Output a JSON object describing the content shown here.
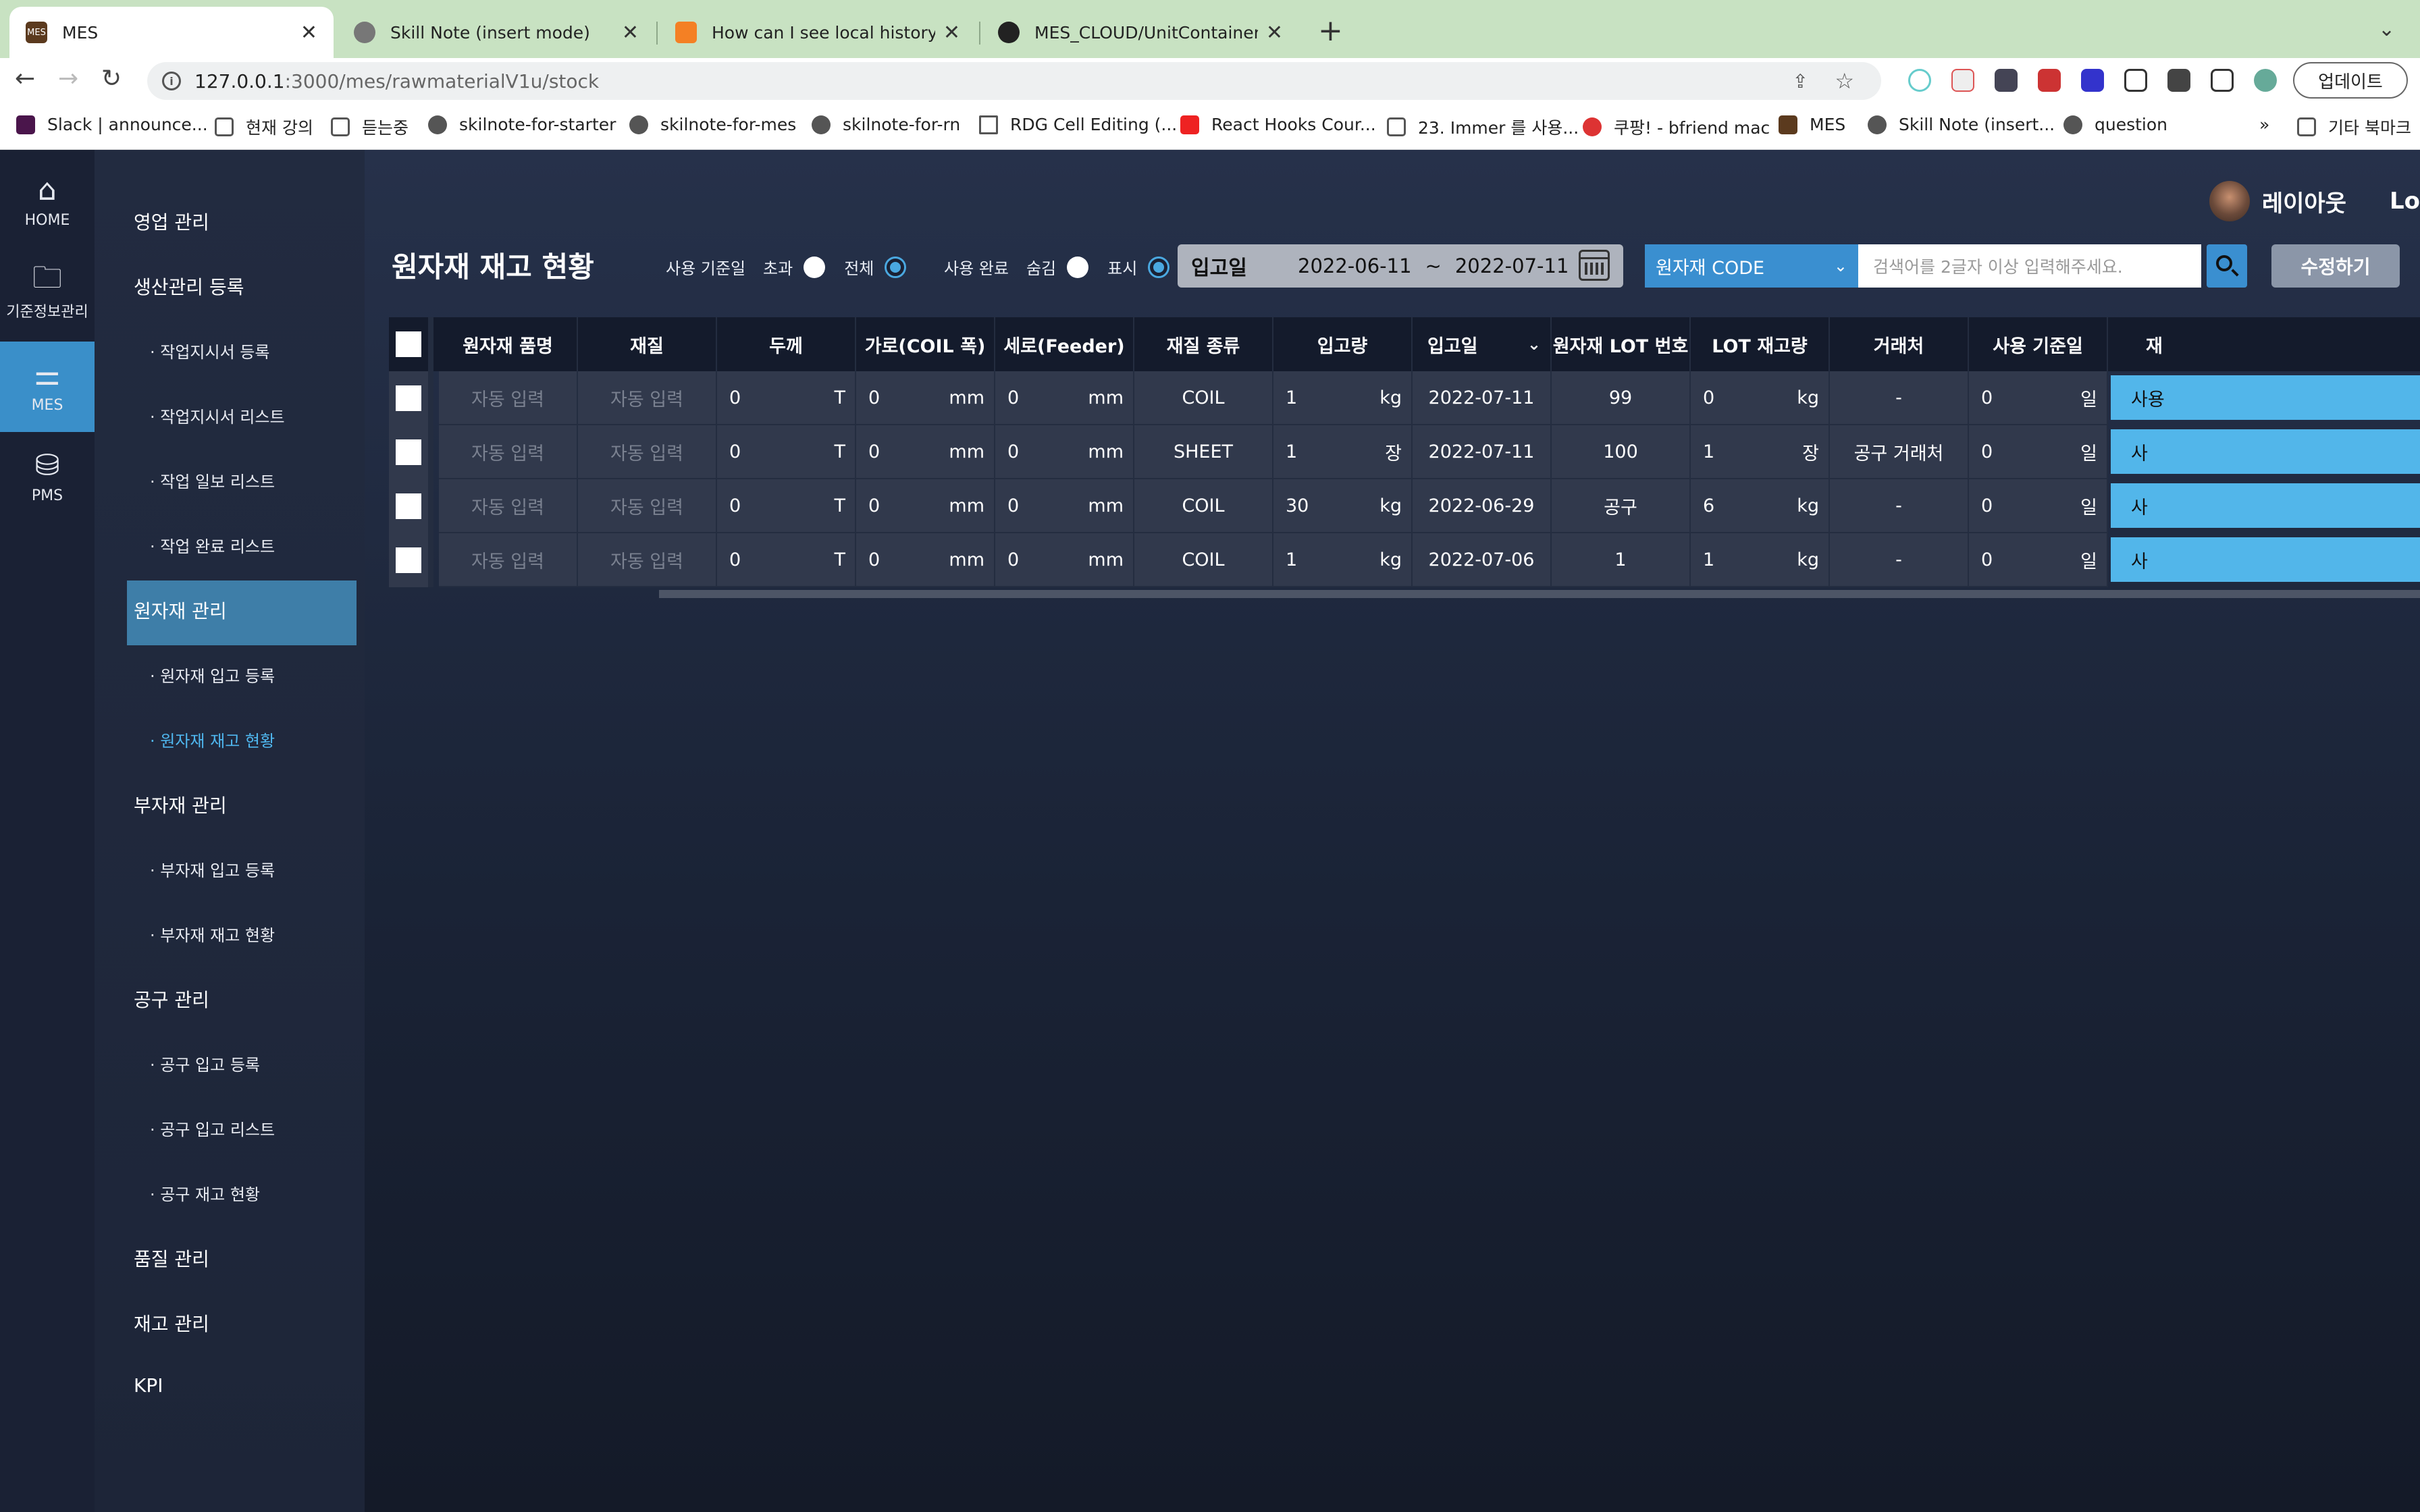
{
  "browser": {
    "tabs": [
      {
        "title": "MES",
        "icon": "mes-favicon",
        "active": true
      },
      {
        "title": "Skill Note (insert mode)",
        "icon": "globe-icon"
      },
      {
        "title": "How can I see local history cha",
        "icon": "stackoverflow-icon"
      },
      {
        "title": "MES_CLOUD/UnitContainer.tsx",
        "icon": "github-icon"
      }
    ],
    "url_host": "127.0.0.1",
    "url_path": ":3000/mes/rawmaterialV1u/stock",
    "update_label": "업데이트",
    "bookmarks": [
      {
        "label": "Slack | announce...",
        "icon": "slack-icon"
      },
      {
        "label": "현재 강의",
        "icon": "folder-icon"
      },
      {
        "label": "듣는중",
        "icon": "folder-icon"
      },
      {
        "label": "skilnote-for-starter",
        "icon": "globe-icon"
      },
      {
        "label": "skilnote-for-mes",
        "icon": "globe-icon"
      },
      {
        "label": "skilnote-for-rn",
        "icon": "globe-icon"
      },
      {
        "label": "RDG Cell Editing (...",
        "icon": "page-icon"
      },
      {
        "label": "React Hooks Cour...",
        "icon": "youtube-icon"
      },
      {
        "label": "23. Immer 를 사용...",
        "icon": "book-icon"
      },
      {
        "label": "쿠팡! - bfriend mac",
        "icon": "coupang-icon"
      },
      {
        "label": "MES",
        "icon": "mes-favicon"
      },
      {
        "label": "Skill Note (insert...",
        "icon": "globe-icon"
      },
      {
        "label": "question",
        "icon": "globe-icon"
      }
    ],
    "bookmarks_more": "»",
    "other_bookmarks": "기타 북마크"
  },
  "leftnav": [
    {
      "label": "HOME",
      "icon": "home-icon"
    },
    {
      "label": "기준정보관리",
      "icon": "folder-alert-icon"
    },
    {
      "label": "MES",
      "icon": "sliders-icon",
      "active": true
    },
    {
      "label": "PMS",
      "icon": "press-icon"
    }
  ],
  "menu": {
    "items": [
      {
        "label": "영업 관리",
        "level": 0
      },
      {
        "label": "생산관리 등록",
        "level": 0
      },
      {
        "label": "· 작업지시서 등록",
        "level": 1
      },
      {
        "label": "· 작업지시서 리스트",
        "level": 1
      },
      {
        "label": "· 작업 일보 리스트",
        "level": 1
      },
      {
        "label": "· 작업 완료 리스트",
        "level": 1
      },
      {
        "label": "원자재 관리",
        "level": 0,
        "active": true
      },
      {
        "label": "· 원자재 입고 등록",
        "level": 1
      },
      {
        "label": "· 원자재 재고 현황",
        "level": 1,
        "current": true
      },
      {
        "label": "부자재 관리",
        "level": 0
      },
      {
        "label": "· 부자재 입고 등록",
        "level": 1
      },
      {
        "label": "· 부자재 재고 현황",
        "level": 1
      },
      {
        "label": "공구 관리",
        "level": 0
      },
      {
        "label": "· 공구 입고 등록",
        "level": 1
      },
      {
        "label": "· 공구 입고 리스트",
        "level": 1
      },
      {
        "label": "· 공구 재고 현황",
        "level": 1
      },
      {
        "label": "품질 관리",
        "level": 0
      },
      {
        "label": "재고 관리",
        "level": 0
      },
      {
        "label": "KPI",
        "level": 0
      }
    ]
  },
  "header": {
    "user_name": "레이아웃",
    "logout_partial": "Lo"
  },
  "page": {
    "title": "원자재 재고 현황",
    "filter1": {
      "label": "사용 기준일",
      "opt1": "초과",
      "opt2": "전체",
      "selected": "전체"
    },
    "filter2": {
      "label": "사용 완료",
      "opt1": "숨김",
      "opt2": "표시",
      "selected": "표시"
    },
    "date": {
      "label": "입고일",
      "from": "2022-06-11",
      "sep": "~",
      "to": "2022-07-11"
    },
    "search": {
      "category": "원자재 CODE",
      "placeholder": "검색어를 2글자 이상 입력해주세요."
    },
    "edit_label": "수정하기"
  },
  "table": {
    "headers": [
      "원자재 품명",
      "재질",
      "두께",
      "가로(COIL 폭)",
      "세로(Feeder)",
      "재질 종류",
      "입고량",
      "입고일",
      "원자재 LOT 번호",
      "LOT 재고량",
      "거래처",
      "사용 기준일",
      "재"
    ],
    "placeholder": "자동 입력",
    "rows": [
      {
        "thick": "0",
        "thick_u": "T",
        "width": "0",
        "width_u": "mm",
        "len": "0",
        "len_u": "mm",
        "kind": "COIL",
        "qty": "1",
        "qty_u": "kg",
        "date": "2022-07-11",
        "lot": "99",
        "lot_qty": "0",
        "lot_u": "kg",
        "client": "-",
        "days": "0",
        "days_u": "일",
        "btn": "사용"
      },
      {
        "thick": "0",
        "thick_u": "T",
        "width": "0",
        "width_u": "mm",
        "len": "0",
        "len_u": "mm",
        "kind": "SHEET",
        "qty": "1",
        "qty_u": "장",
        "date": "2022-07-11",
        "lot": "100",
        "lot_qty": "1",
        "lot_u": "장",
        "client": "공구 거래처",
        "days": "0",
        "days_u": "일",
        "btn": "사"
      },
      {
        "thick": "0",
        "thick_u": "T",
        "width": "0",
        "width_u": "mm",
        "len": "0",
        "len_u": "mm",
        "kind": "COIL",
        "qty": "30",
        "qty_u": "kg",
        "date": "2022-06-29",
        "lot": "공구",
        "lot_qty": "6",
        "lot_u": "kg",
        "client": "-",
        "days": "0",
        "days_u": "일",
        "btn": "사"
      },
      {
        "thick": "0",
        "thick_u": "T",
        "width": "0",
        "width_u": "mm",
        "len": "0",
        "len_u": "mm",
        "kind": "COIL",
        "qty": "1",
        "qty_u": "kg",
        "date": "2022-07-06",
        "lot": "1",
        "lot_qty": "1",
        "lot_u": "kg",
        "client": "-",
        "days": "0",
        "days_u": "일",
        "btn": "사"
      }
    ]
  }
}
